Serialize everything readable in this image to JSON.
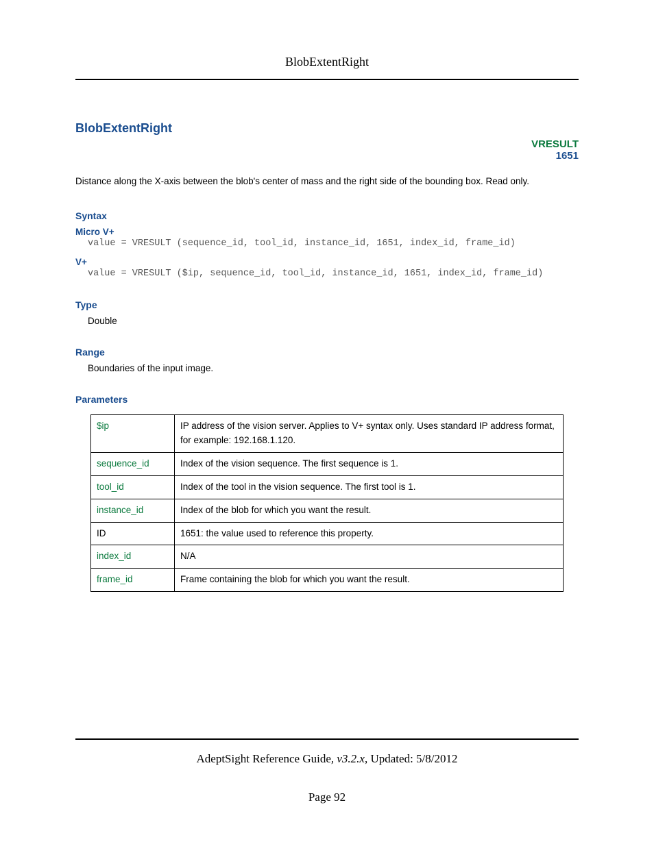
{
  "page_header": "BlobExtentRight",
  "title": "BlobExtentRight",
  "property_code": "VRESULT",
  "property_id": "1651",
  "description": "Distance along the X-axis between the blob's center of mass and the right side of the bounding box. Read only.",
  "syntax": {
    "heading": "Syntax",
    "micro_label": "Micro V+",
    "micro_code": "value = VRESULT (sequence_id, tool_id, instance_id, 1651, index_id, frame_id)",
    "vplus_label": "V+",
    "vplus_code": "value = VRESULT ($ip, sequence_id, tool_id, instance_id, 1651, index_id, frame_id)"
  },
  "type": {
    "heading": "Type",
    "value": "Double"
  },
  "range": {
    "heading": "Range",
    "value": "Boundaries of the input image."
  },
  "parameters": {
    "heading": "Parameters",
    "rows": [
      {
        "name": "$ip",
        "plain": false,
        "desc": "IP address of the vision server. Applies to V+ syntax only. Uses standard IP address format, for example: 192.168.1.120."
      },
      {
        "name": "sequence_id",
        "plain": false,
        "desc": "Index of the vision sequence. The first sequence is 1."
      },
      {
        "name": "tool_id",
        "plain": false,
        "desc": "Index of the tool in the vision sequence. The first tool is 1."
      },
      {
        "name": "instance_id",
        "plain": false,
        "desc": "Index of the blob for which you want the result."
      },
      {
        "name": "ID",
        "plain": true,
        "desc": "1651: the value used to reference this property."
      },
      {
        "name": "index_id",
        "plain": false,
        "desc": "N/A"
      },
      {
        "name": "frame_id",
        "plain": false,
        "desc": "Frame containing the blob for which you want the result."
      }
    ]
  },
  "footer": {
    "guide_prefix": "AdeptSight Reference Guide",
    "guide_version": ", v3.2.x",
    "guide_suffix": ", Updated: 5/8/2012",
    "page_label": "Page 92"
  }
}
